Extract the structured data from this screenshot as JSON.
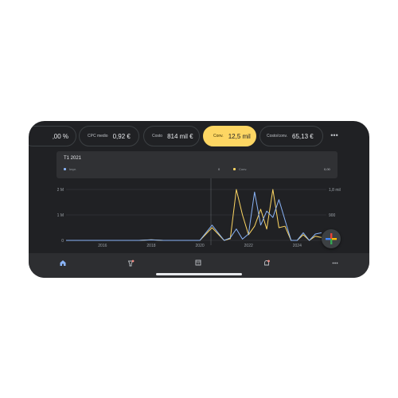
{
  "metrics": [
    {
      "label": "",
      "value": "‚00 %",
      "active": false
    },
    {
      "label": "CPC medio",
      "value": "0,92 €",
      "active": false
    },
    {
      "label": "Costo",
      "value": "814 mil €",
      "active": false
    },
    {
      "label": "Conv.",
      "value": "12,5 mil",
      "active": true
    },
    {
      "label": "Costo/conv.",
      "value": "65,13 €",
      "active": false
    }
  ],
  "more_icon": "more-horizontal-icon",
  "tooltip": {
    "title": "T1 2021",
    "rows": [
      {
        "label": "Impr.",
        "value": "0",
        "color": "#8ab4f8"
      },
      {
        "label": "Conv.",
        "value": "0,00",
        "color": "#fdd663"
      }
    ]
  },
  "chart_data": {
    "type": "line",
    "x_ticks": [
      "2016",
      "2018",
      "2020",
      "2022",
      "2024"
    ],
    "y_left_ticks": [
      "2 M",
      "1 M",
      "0"
    ],
    "y_right_ticks": [
      "1,8 mil",
      "900",
      "0"
    ],
    "x": [
      2014.5,
      2015,
      2015.5,
      2016,
      2016.5,
      2017,
      2017.5,
      2018,
      2018.5,
      2019,
      2019.5,
      2020,
      2020.5,
      2021,
      2021.25,
      2021.5,
      2021.75,
      2022,
      2022.25,
      2022.5,
      2022.75,
      2023,
      2023.25,
      2023.5,
      2023.75,
      2024,
      2024.25,
      2024.5,
      2024.75,
      2025
    ],
    "series": [
      {
        "name": "Impr.",
        "color": "#8ab4f8",
        "axis": "left",
        "values": [
          0.0,
          0.0,
          0.0,
          0.0,
          0.0,
          0.0,
          0.0,
          0.02,
          0.0,
          0.0,
          0.0,
          0.0,
          0.6,
          0.0,
          0.1,
          0.45,
          0.05,
          0.25,
          1.9,
          0.6,
          1.15,
          0.9,
          1.6,
          0.8,
          0.0,
          0.0,
          0.3,
          0.0,
          0.25,
          0.3
        ]
      },
      {
        "name": "Conv.",
        "color": "#fdd663",
        "axis": "right",
        "values": [
          0,
          0,
          0,
          0,
          0,
          0,
          0,
          20,
          0,
          0,
          0,
          0,
          450,
          0,
          60,
          1800,
          900,
          200,
          500,
          1100,
          400,
          1800,
          450,
          500,
          0,
          0,
          200,
          0,
          150,
          100
        ]
      }
    ],
    "y_left_range": [
      0,
      2
    ],
    "y_right_range": [
      0,
      1800
    ],
    "x_range": [
      2014.5,
      2025.2
    ],
    "grid": true
  },
  "nav": [
    {
      "icon": "home-icon",
      "active": true
    },
    {
      "icon": "campaigns-icon",
      "active": false
    },
    {
      "icon": "calendar-icon",
      "active": false
    },
    {
      "icon": "notifications-icon",
      "active": false
    },
    {
      "icon": "more-horizontal-icon",
      "active": false
    }
  ],
  "fab_icon": "add-icon"
}
